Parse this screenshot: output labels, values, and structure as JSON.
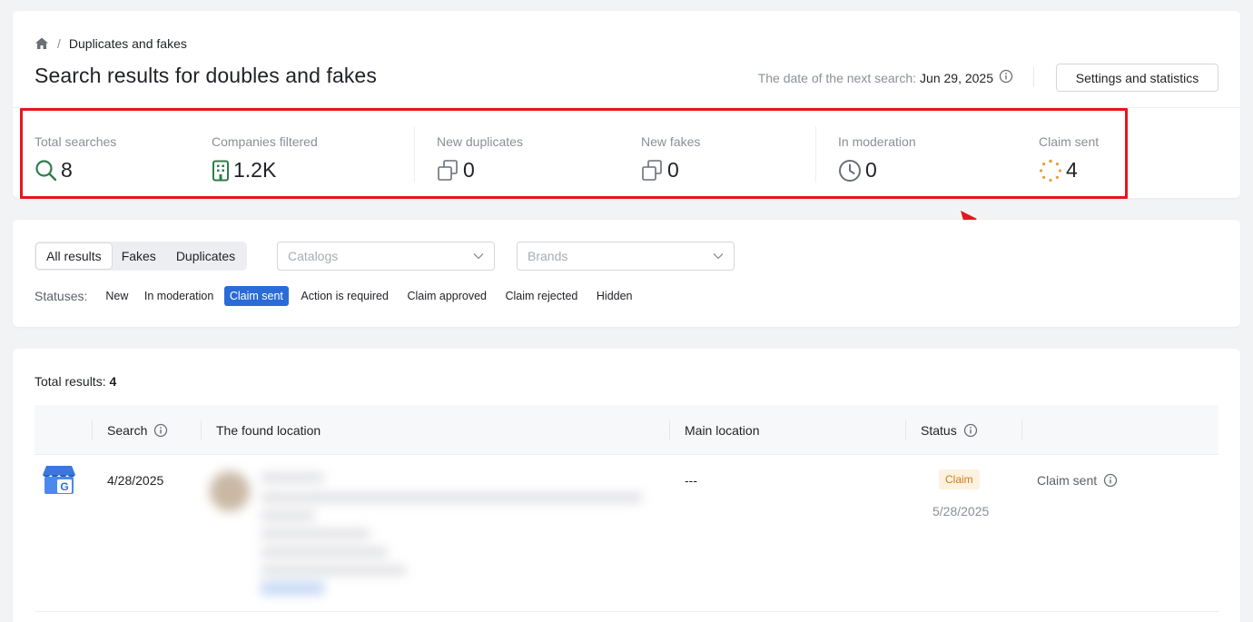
{
  "breadcrumb": {
    "current": "Duplicates and fakes"
  },
  "header": {
    "title": "Search results for doubles and fakes",
    "next_search_label": "The date of the next search:",
    "next_search_date": "Jun 29, 2025",
    "settings_button": "Settings and statistics"
  },
  "stats": [
    {
      "label": "Total searches",
      "value": "8",
      "icon": "search-icon"
    },
    {
      "label": "Companies filtered",
      "value": "1.2K",
      "icon": "building-icon"
    },
    {
      "label": "New duplicates",
      "value": "0",
      "icon": "copy-icon"
    },
    {
      "label": "New fakes",
      "value": "0",
      "icon": "copy-icon"
    },
    {
      "label": "In moderation",
      "value": "0",
      "icon": "clock-icon"
    },
    {
      "label": "Claim sent",
      "value": "4",
      "icon": "spinner-icon"
    }
  ],
  "filters": {
    "tabs": [
      "All results",
      "Fakes",
      "Duplicates"
    ],
    "active_tab": "All results",
    "catalogs_placeholder": "Catalogs",
    "brands_placeholder": "Brands",
    "statuses_label": "Statuses:",
    "statuses": [
      "New",
      "In moderation",
      "Claim sent",
      "Action is required",
      "Claim approved",
      "Claim rejected",
      "Hidden"
    ],
    "active_status": "Claim sent"
  },
  "results": {
    "total_label": "Total results:",
    "total_value": "4",
    "columns": [
      "Search",
      "The found location",
      "Main location",
      "Status"
    ],
    "rows": [
      {
        "source_icon": "google-business-icon",
        "search_date": "4/28/2025",
        "main_location": "---",
        "badge": "Claim",
        "status_date": "5/28/2025",
        "status": "Claim sent"
      }
    ]
  },
  "colors": {
    "accent": "#2a6bd8",
    "highlight": "#e5161d",
    "badge_bg": "#fdf1df",
    "badge_text": "#c8801c",
    "icon_green": "#2f7d4a",
    "icon_orange": "#e8a03c"
  }
}
